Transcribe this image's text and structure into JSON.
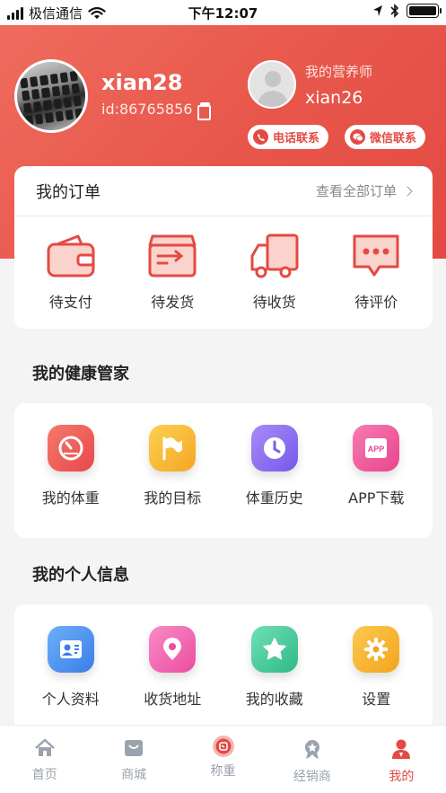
{
  "status_bar": {
    "carrier": "极信通信",
    "time": "下午12:07"
  },
  "user": {
    "name": "xian28",
    "id": "id:86765856"
  },
  "nutritionist": {
    "title": "我的营养师",
    "name": "xian26",
    "phone_button": "电话联系",
    "wechat_button": "微信联系"
  },
  "orders": {
    "title": "我的订单",
    "view_all": "查看全部订单",
    "items": [
      {
        "label": "待支付",
        "icon": "wallet-icon"
      },
      {
        "label": "待发货",
        "icon": "box-icon"
      },
      {
        "label": "待收货",
        "icon": "truck-icon"
      },
      {
        "label": "待评价",
        "icon": "comment-icon"
      }
    ]
  },
  "health": {
    "title": "我的健康管家",
    "items": [
      {
        "label": "我的体重",
        "icon": "scale-gauge-icon",
        "color": "#ef5a5a"
      },
      {
        "label": "我的目标",
        "icon": "flag-icon",
        "color": "#f8b73b"
      },
      {
        "label": "体重历史",
        "icon": "clock-icon",
        "color": "#8c6cf2"
      },
      {
        "label": "APP下载",
        "icon": "app-icon",
        "color": "#ee5aa0"
      }
    ]
  },
  "personal": {
    "title": "我的个人信息",
    "items": [
      {
        "label": "个人资料",
        "icon": "profile-card-icon",
        "color": "#4a8df0"
      },
      {
        "label": "收货地址",
        "icon": "location-icon",
        "color": "#f35bb0"
      },
      {
        "label": "我的收藏",
        "icon": "star-icon",
        "color": "#3cc99a"
      },
      {
        "label": "设置",
        "icon": "gear-icon",
        "color": "#f6b12d"
      }
    ]
  },
  "tabbar": [
    {
      "label": "首页",
      "icon": "home-icon"
    },
    {
      "label": "商城",
      "icon": "shop-icon"
    },
    {
      "label": "称重",
      "icon": "weigh-icon"
    },
    {
      "label": "经销商",
      "icon": "dealer-icon"
    },
    {
      "label": "我的",
      "icon": "me-icon",
      "active": true
    }
  ],
  "colors": {
    "brand": "#e34a43",
    "inactive_tab": "#9aa3ad"
  }
}
